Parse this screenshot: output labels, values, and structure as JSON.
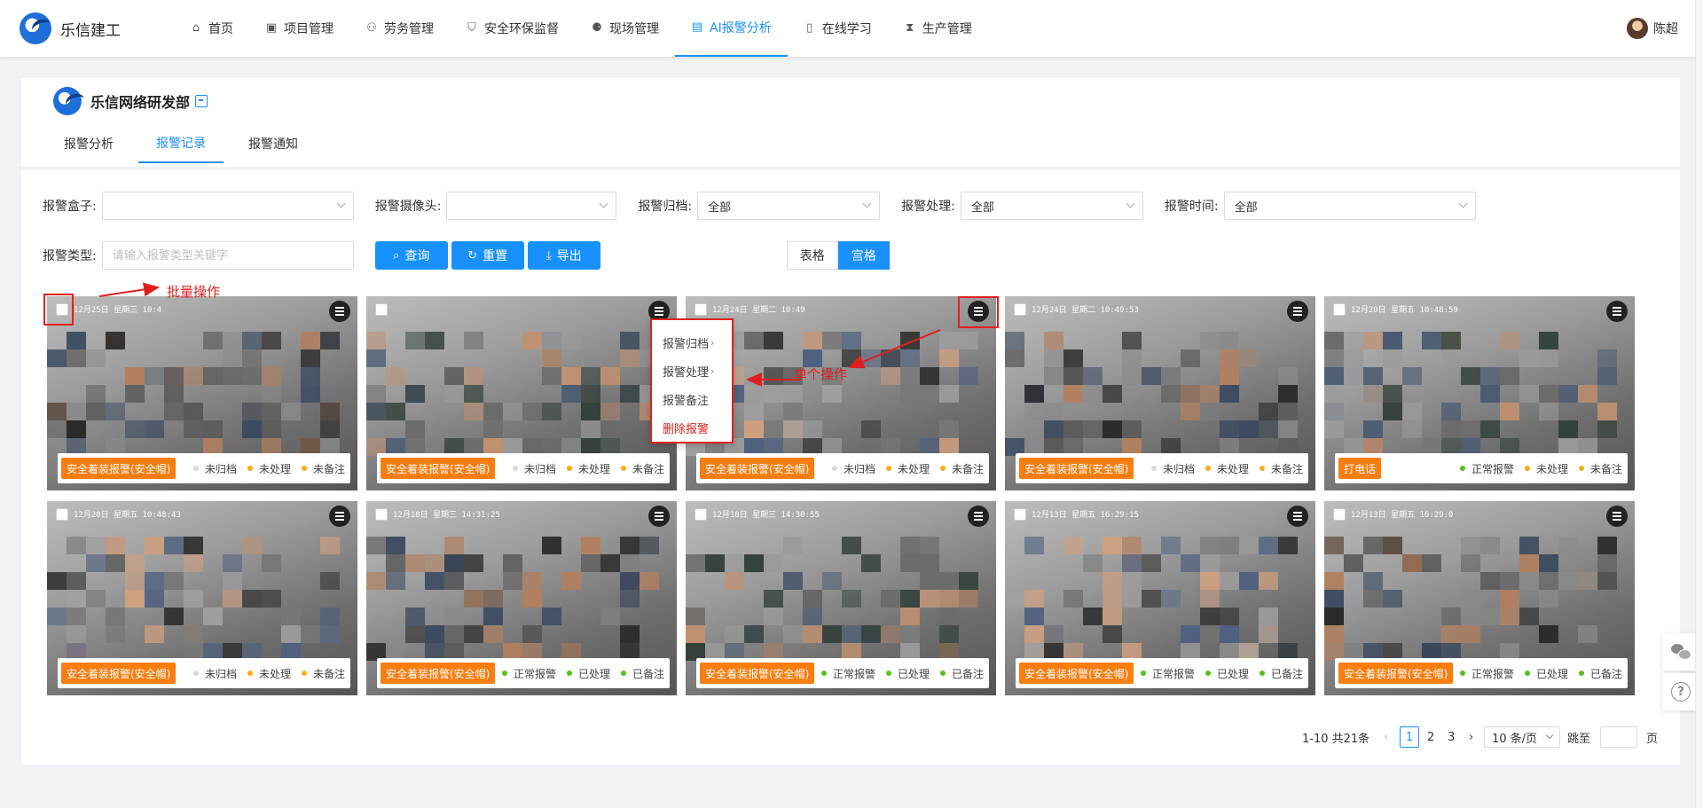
{
  "brand": {
    "name": "乐信建工"
  },
  "nav": [
    {
      "label": "首页",
      "icon": "home-icon",
      "glyph": "⌂"
    },
    {
      "label": "项目管理",
      "icon": "project-icon",
      "glyph": "▣"
    },
    {
      "label": "劳务管理",
      "icon": "labor-icon",
      "glyph": "⚇"
    },
    {
      "label": "安全环保监督",
      "icon": "shield-icon",
      "glyph": "⛉"
    },
    {
      "label": "现场管理",
      "icon": "site-icon",
      "glyph": "⚈"
    },
    {
      "label": "AI报警分析",
      "icon": "ai-alarm-icon",
      "glyph": "▤",
      "active": true
    },
    {
      "label": "在线学习",
      "icon": "book-icon",
      "glyph": "▯"
    },
    {
      "label": "生产管理",
      "icon": "hourglass-icon",
      "glyph": "⧗"
    }
  ],
  "user": {
    "name": "陈超"
  },
  "dept": {
    "name": "乐信网络研发部"
  },
  "tabs": [
    {
      "label": "报警分析"
    },
    {
      "label": "报警记录",
      "active": true
    },
    {
      "label": "报警通知"
    }
  ],
  "filters": {
    "box_label": "报警盒子:",
    "camera_label": "报警摄像头:",
    "archive_label": "报警归档:",
    "archive_value": "全部",
    "handle_label": "报警处理:",
    "handle_value": "全部",
    "time_label": "报警时间:",
    "time_value": "全部",
    "type_label": "报警类型:",
    "type_placeholder": "请输入报警类型关键字"
  },
  "buttons": {
    "query": "查询",
    "reset": "重置",
    "export": "导出"
  },
  "view_toggle": {
    "table": "表格",
    "grid": "宫格"
  },
  "cards": [
    {
      "ts": "12月25日 星期三 10:4",
      "tag": "安全着装报警(安全帽)",
      "s1": "未归档",
      "c1": "#d9d9d9",
      "s2": "未处理",
      "c2": "#faad14",
      "s3": "未备注",
      "c3": "#faad14"
    },
    {
      "ts": "",
      "tag": "安全着装报警(安全帽)",
      "s1": "未归档",
      "c1": "#d9d9d9",
      "s2": "未处理",
      "c2": "#faad14",
      "s3": "未备注",
      "c3": "#faad14"
    },
    {
      "ts": "12月24日 星期二 10:49",
      "tag": "安全着装报警(安全帽)",
      "s1": "未归档",
      "c1": "#d9d9d9",
      "s2": "未处理",
      "c2": "#faad14",
      "s3": "未备注",
      "c3": "#faad14"
    },
    {
      "ts": "12月24日 星期二 10:49:53",
      "tag": "安全着装报警(安全帽)",
      "s1": "未归档",
      "c1": "#d9d9d9",
      "s2": "未处理",
      "c2": "#faad14",
      "s3": "未备注",
      "c3": "#faad14"
    },
    {
      "ts": "12月20日 星期五 10:48:59",
      "tag": "打电话",
      "s1": "正常报警",
      "c1": "#52c41a",
      "s2": "未处理",
      "c2": "#faad14",
      "s3": "未备注",
      "c3": "#faad14"
    },
    {
      "ts": "12月20日 星期五 10:48:43",
      "tag": "安全着装报警(安全帽)",
      "s1": "未归档",
      "c1": "#d9d9d9",
      "s2": "未处理",
      "c2": "#faad14",
      "s3": "未备注",
      "c3": "#faad14"
    },
    {
      "ts": "12月18日 星期三 14:31:25",
      "tag": "安全着装报警(安全帽)",
      "s1": "正常报警",
      "c1": "#52c41a",
      "s2": "已处理",
      "c2": "#52c41a",
      "s3": "已备注",
      "c3": "#52c41a"
    },
    {
      "ts": "12月18日 星期三 14:30:55",
      "tag": "安全着装报警(安全帽)",
      "s1": "正常报警",
      "c1": "#52c41a",
      "s2": "已处理",
      "c2": "#52c41a",
      "s3": "已备注",
      "c3": "#52c41a"
    },
    {
      "ts": "12月13日 星期五 16:29:15",
      "tag": "安全着装报警(安全帽)",
      "s1": "正常报警",
      "c1": "#52c41a",
      "s2": "已处理",
      "c2": "#52c41a",
      "s3": "已备注",
      "c3": "#52c41a"
    },
    {
      "ts": "12月13日 星期五 16:29:0",
      "tag": "安全着装报警(安全帽)",
      "s1": "正常报警",
      "c1": "#52c41a",
      "s2": "已处理",
      "c2": "#52c41a",
      "s3": "已备注",
      "c3": "#52c41a"
    }
  ],
  "dropdown": {
    "archive": "报警归档",
    "handle": "报警处理",
    "note": "报警备注",
    "delete": "删除报警"
  },
  "annotations": {
    "batch": "批量操作",
    "single": "单个操作"
  },
  "pagination": {
    "summary": "1-10 共21条",
    "pages": [
      "1",
      "2",
      "3"
    ],
    "size": "10 条/页",
    "jump_label": "跳至",
    "page_unit": "页"
  },
  "colors": {
    "accent": "#1890ff",
    "tag": "#fa7d0f",
    "annotation": "#e02020"
  }
}
